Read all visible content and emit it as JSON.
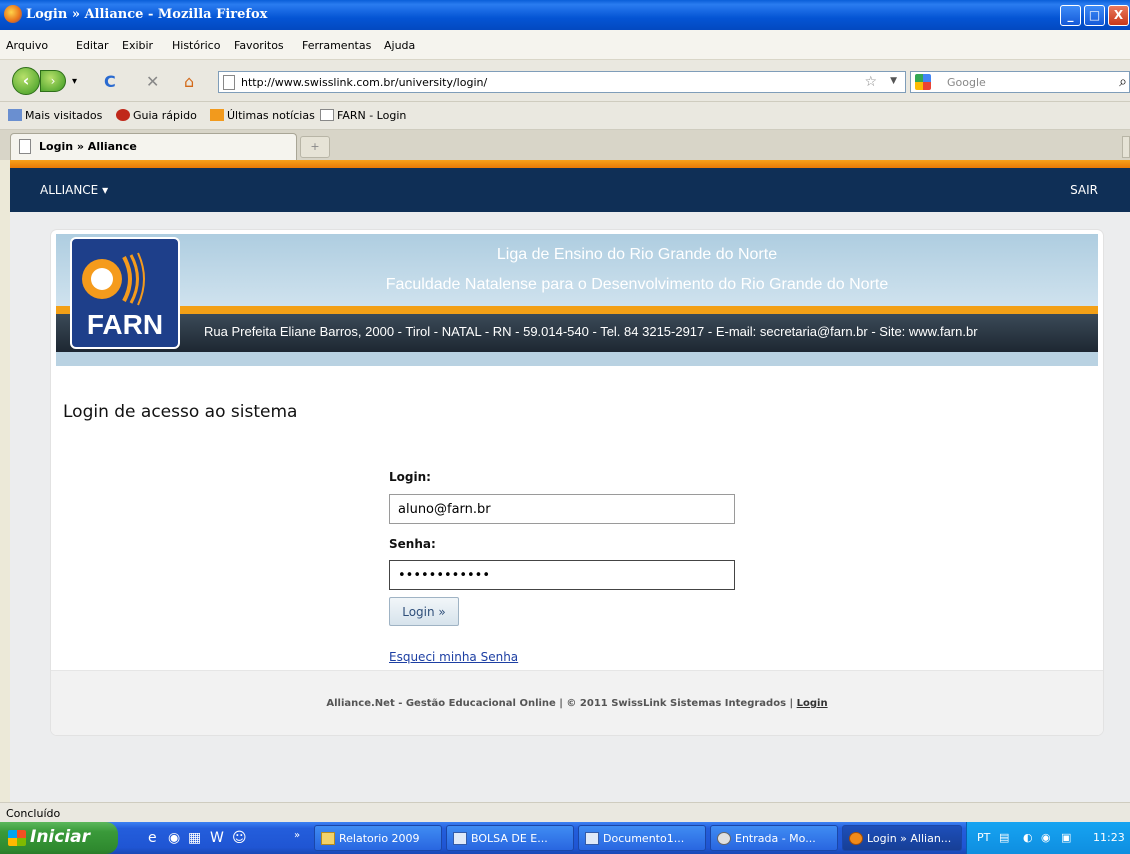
{
  "window": {
    "title": "Login » Alliance - Mozilla Firefox",
    "buttons": {
      "minimize": "_",
      "maximize": "□",
      "close": "X"
    }
  },
  "menu": [
    "Arquivo",
    "Editar",
    "Exibir",
    "Histórico",
    "Favoritos",
    "Ferramentas",
    "Ajuda"
  ],
  "navigation": {
    "url": "http://www.swisslink.com.br/university/login/",
    "search_placeholder": "Google",
    "icons": [
      "back-icon",
      "forward-icon",
      "reload-icon",
      "stop-icon",
      "home-icon",
      "bookmark-star-icon",
      "search-icon"
    ]
  },
  "bookmarks": [
    "Mais visitados",
    "Guia rápido",
    "Últimas notícias",
    "FARN - Login"
  ],
  "tabs": [
    {
      "label": "Login » Alliance",
      "active": true
    }
  ],
  "newtab_label": "+",
  "site": {
    "nav_menu": "ALLIANCE",
    "nav_logout": "SAIR",
    "banner": {
      "logo_text": "FARN",
      "line1": "Liga de Ensino do Rio Grande do Norte",
      "line2": "Faculdade Natalense para o Desenvolvimento do Rio Grande do Norte",
      "address": "Rua Prefeita Eliane Barros, 2000 - Tirol - NATAL - RN - 59.014-540  - Tel. 84 3215-2917 - E-mail: secretaria@farn.br - Site: www.farn.br"
    },
    "login": {
      "title": "Login de acesso ao sistema",
      "login_label": "Login:",
      "login_value": "aluno@farn.br",
      "password_label": "Senha:",
      "password_value": "••••••••••••",
      "submit_label": "Login »",
      "forgot_label": "Esqueci minha Senha"
    },
    "footer": {
      "text": "Alliance.Net - Gestão Educacional Online | © 2011 SwissLink Sistemas Integrados | ",
      "link": "Login"
    }
  },
  "statusbar": "Concluído",
  "taskbar": {
    "start_label": "Iniciar",
    "tasks": [
      "Relatorio 2009",
      "BOLSA DE E...",
      "Documento1...",
      "Entrada - Mo...",
      "Login » Allian..."
    ],
    "active_task_index": 4,
    "language": "PT",
    "clock": "11:23"
  },
  "colors": {
    "site_nav": "#0f2f56",
    "accent_orange": "#f3a016",
    "xp_blue": "#245edc"
  }
}
